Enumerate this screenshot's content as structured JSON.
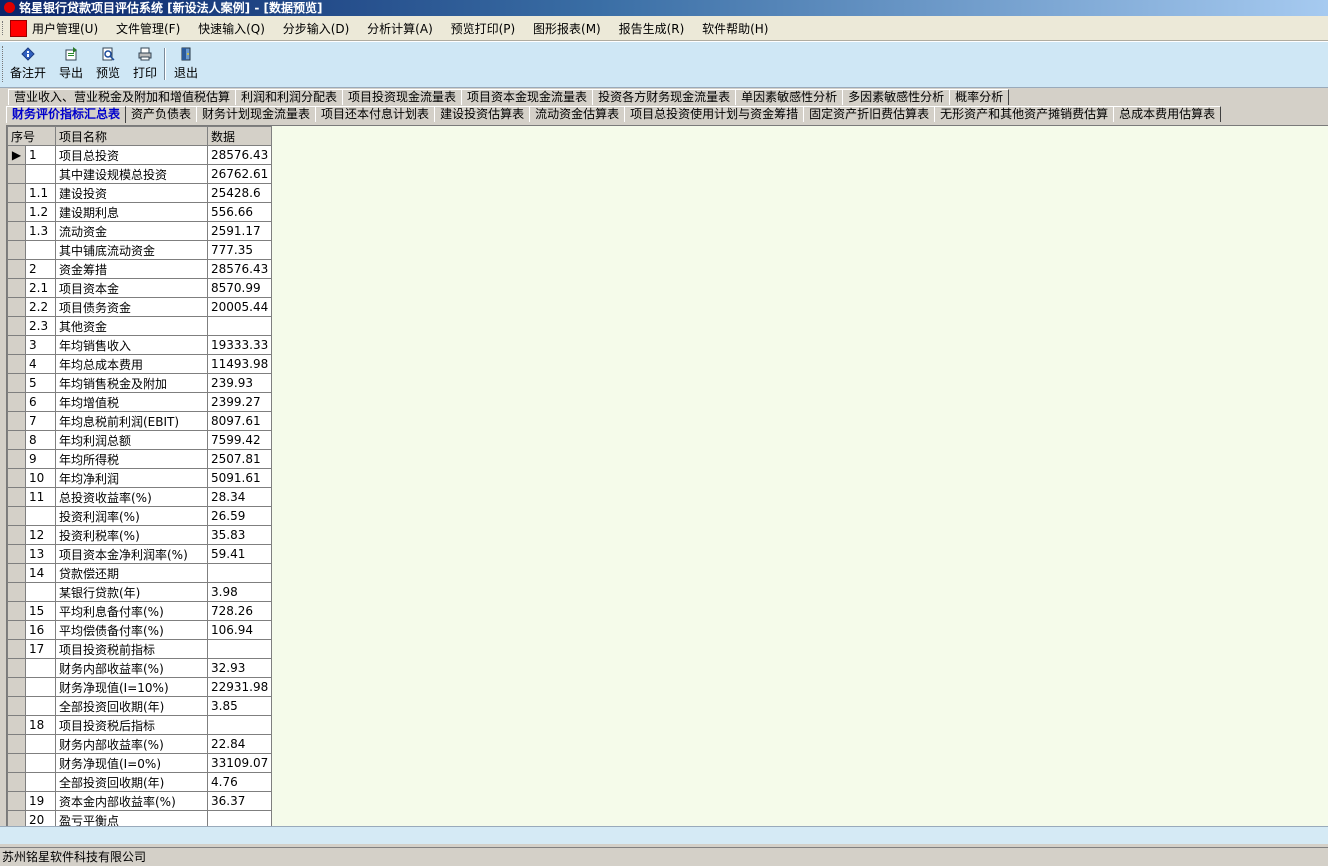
{
  "window": {
    "title": "铭星银行贷款项目评估系统 [新设法人案例] - [数据预览]"
  },
  "menu": [
    "用户管理(U)",
    "文件管理(F)",
    "快速输入(Q)",
    "分步输入(D)",
    "分析计算(A)",
    "预览打印(P)",
    "图形报表(M)",
    "报告生成(R)",
    "软件帮助(H)"
  ],
  "toolbar": {
    "buttons": [
      {
        "label": "备注开",
        "icon": "info-icon"
      },
      {
        "label": "导出",
        "icon": "export-icon"
      },
      {
        "label": "预览",
        "icon": "preview-icon"
      },
      {
        "label": "打印",
        "icon": "print-icon"
      },
      {
        "label": "退出",
        "icon": "exit-icon"
      }
    ]
  },
  "tabs_row1": [
    "营业收入、营业税金及附加和增值税估算",
    "利润和利润分配表",
    "项目投资现金流量表",
    "项目资本金现金流量表",
    "投资各方财务现金流量表",
    "单因素敏感性分析",
    "多因素敏感性分析",
    "概率分析"
  ],
  "tabs_row2": [
    "财务评价指标汇总表",
    "资产负债表",
    "财务计划现金流量表",
    "项目还本付息计划表",
    "建设投资估算表",
    "流动资金估算表",
    "项目总投资使用计划与资金筹措",
    "固定资产折旧费估算表",
    "无形资产和其他资产摊销费估算",
    "总成本费用估算表"
  ],
  "table": {
    "headers": [
      "序号",
      "项目名称",
      "数据"
    ],
    "rows": [
      {
        "no": "1",
        "name": "项目总投资",
        "value": "28576.43"
      },
      {
        "no": "",
        "name": "其中建设规模总投资",
        "value": "26762.61"
      },
      {
        "no": "1.1",
        "name": "建设投资",
        "value": "25428.6"
      },
      {
        "no": "1.2",
        "name": "建设期利息",
        "value": "556.66"
      },
      {
        "no": "1.3",
        "name": "流动资金",
        "value": "2591.17"
      },
      {
        "no": "",
        "name": "其中铺底流动资金",
        "value": "777.35"
      },
      {
        "no": "2",
        "name": "资金筹措",
        "value": "28576.43"
      },
      {
        "no": "2.1",
        "name": "项目资本金",
        "value": "8570.99"
      },
      {
        "no": "2.2",
        "name": "项目债务资金",
        "value": "20005.44"
      },
      {
        "no": "2.3",
        "name": "其他资金",
        "value": ""
      },
      {
        "no": "3",
        "name": "年均销售收入",
        "value": "19333.33"
      },
      {
        "no": "4",
        "name": "年均总成本费用",
        "value": "11493.98"
      },
      {
        "no": "5",
        "name": "年均销售税金及附加",
        "value": "239.93"
      },
      {
        "no": "6",
        "name": "年均增值税",
        "value": "2399.27"
      },
      {
        "no": "7",
        "name": "年均息税前利润(EBIT)",
        "value": "8097.61"
      },
      {
        "no": "8",
        "name": "年均利润总额",
        "value": "7599.42"
      },
      {
        "no": "9",
        "name": "年均所得税",
        "value": "2507.81"
      },
      {
        "no": "10",
        "name": "年均净利润",
        "value": "5091.61"
      },
      {
        "no": "11",
        "name": "总投资收益率(%)",
        "value": "28.34"
      },
      {
        "no": "",
        "name": "投资利润率(%)",
        "value": "26.59"
      },
      {
        "no": "12",
        "name": "投资利税率(%)",
        "value": "35.83"
      },
      {
        "no": "13",
        "name": "项目资本金净利润率(%)",
        "value": "59.41"
      },
      {
        "no": "14",
        "name": "贷款偿还期",
        "value": ""
      },
      {
        "no": "",
        "name": "某银行贷款(年)",
        "value": "3.98"
      },
      {
        "no": "15",
        "name": "平均利息备付率(%)",
        "value": "728.26"
      },
      {
        "no": "16",
        "name": "平均偿债备付率(%)",
        "value": "106.94"
      },
      {
        "no": "17",
        "name": "项目投资税前指标",
        "value": ""
      },
      {
        "no": "",
        "name": "财务内部收益率(%)",
        "value": "32.93"
      },
      {
        "no": "",
        "name": "财务净现值(I=10%)",
        "value": "22931.98"
      },
      {
        "no": "",
        "name": "全部投资回收期(年)",
        "value": "3.85"
      },
      {
        "no": "18",
        "name": "项目投资税后指标",
        "value": ""
      },
      {
        "no": "",
        "name": "财务内部收益率(%)",
        "value": "22.84"
      },
      {
        "no": "",
        "name": "财务净现值(I=0%)",
        "value": "33109.07"
      },
      {
        "no": "",
        "name": "全部投资回收期(年)",
        "value": "4.76"
      },
      {
        "no": "19",
        "name": "资本金内部收益率(%)",
        "value": "36.37"
      },
      {
        "no": "20",
        "name": "盈亏平衡点",
        "value": ""
      }
    ]
  },
  "status": {
    "company": "苏州铭星软件科技有限公司"
  },
  "colors": {
    "grid_bg": "#f5fbea",
    "toolbar_bg": "#cfe7f5",
    "active_tab_text": "#0000cc"
  }
}
